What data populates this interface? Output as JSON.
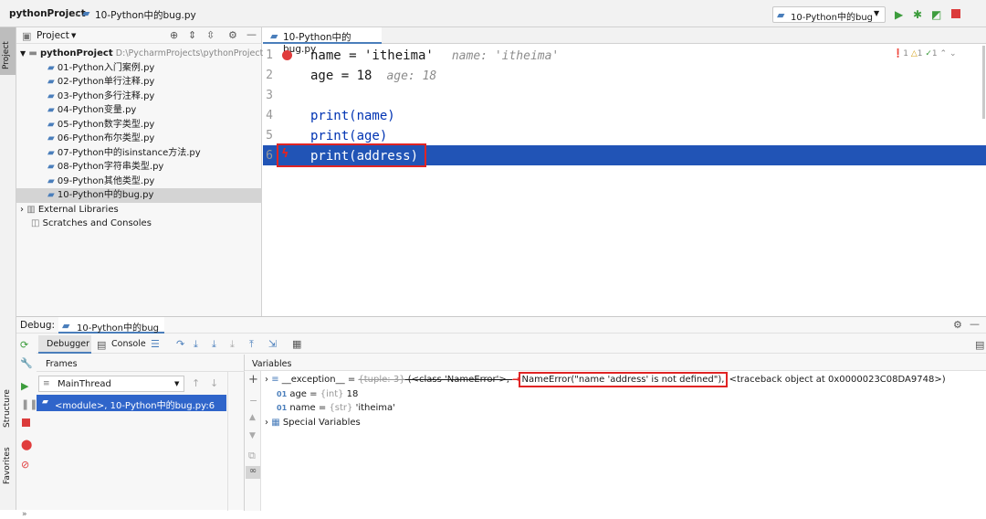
{
  "nav": {
    "project": "pythonProject",
    "file": "10-Python中的bug.py",
    "run_config": "10-Python中的bug"
  },
  "left_strip": {
    "project_label": "Project",
    "structure_label": "Structure",
    "favorites_label": "Favorites"
  },
  "project_panel": {
    "title": "Project",
    "root_name": "pythonProject",
    "root_path": "D:\\PycharmProjects\\pythonProject",
    "files": [
      "01-Python入门案例.py",
      "02-Python单行注释.py",
      "03-Python多行注释.py",
      "04-Python变量.py",
      "05-Python数字类型.py",
      "06-Python布尔类型.py",
      "07-Python中的isinstance方法.py",
      "08-Python字符串类型.py",
      "09-Python其他类型.py",
      "10-Python中的bug.py"
    ],
    "external": "External Libraries",
    "scratches": "Scratches and Consoles"
  },
  "editor": {
    "tab": "10-Python中的bug.py",
    "inspection": {
      "errors": "1",
      "warnings": "1",
      "weak": "1"
    },
    "lines": [
      {
        "num": "1",
        "code": "name = 'itheima'",
        "hint": "name: 'itheima'"
      },
      {
        "num": "2",
        "code": "age = 18",
        "hint": "age: 18"
      },
      {
        "num": "3",
        "code": "",
        "hint": ""
      },
      {
        "num": "4",
        "code": "print(name)",
        "hint": ""
      },
      {
        "num": "5",
        "code": "print(age)",
        "hint": ""
      },
      {
        "num": "6",
        "code": "print(address)",
        "hint": ""
      }
    ]
  },
  "debug": {
    "label": "Debug:",
    "session": "10-Python中的bug",
    "tab_debugger": "Debugger",
    "tab_console": "Console",
    "frames_title": "Frames",
    "thread": "MainThread",
    "frame": "<module>, 10-Python中的bug.py:6",
    "variables_title": "Variables",
    "vars": [
      {
        "name": "__exception__",
        "eq": " = ",
        "type": "{tuple: 3}",
        "mid": " (<class 'NameError'>, ",
        "err": "NameError(\"name 'address' is not defined\"),",
        "tail": " <traceback object at 0x0000023C08DA9748>)"
      },
      {
        "name": "age",
        "eq": " = ",
        "type": "{int}",
        "val": " 18"
      },
      {
        "name": "name",
        "eq": " = ",
        "type": "{str}",
        "val": " 'itheima'"
      },
      {
        "name": "Special Variables"
      }
    ]
  },
  "colors": {
    "accent": "#2f65ca",
    "error": "#e02424",
    "run": "#3c9c3c"
  }
}
